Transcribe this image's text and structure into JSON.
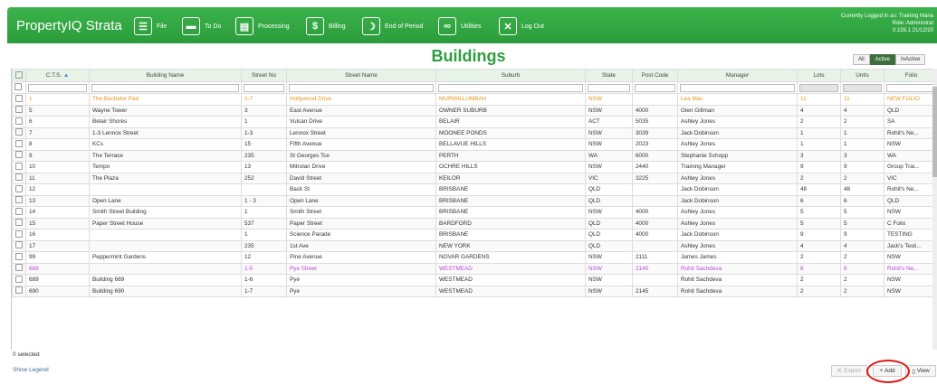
{
  "header": {
    "logo": "PropertyIQ Strata",
    "nav": [
      {
        "label": "File",
        "icon": "file-icon"
      },
      {
        "label": "To Do",
        "icon": "chat-icon"
      },
      {
        "label": "Processing",
        "icon": "document-icon"
      },
      {
        "label": "Billing",
        "icon": "dollar-icon"
      },
      {
        "label": "End of Period",
        "icon": "moon-icon"
      },
      {
        "label": "Utilities",
        "icon": "link-icon"
      },
      {
        "label": "Log Out",
        "icon": "close-icon"
      }
    ],
    "user_line1": "Currently Logged In as: Training Mana",
    "user_line2": "Role: Administrat",
    "user_line3": "0.135.1 21/12/20"
  },
  "page_title": "Buildings",
  "filters": {
    "all": "All",
    "active": "Active",
    "inactive": "InActive"
  },
  "columns": [
    "C.T.S.",
    "Building Name",
    "Street No",
    "Street Name",
    "Suburb",
    "State",
    "Post Code",
    "Manager",
    "Lots",
    "Units",
    "Folio"
  ],
  "sort_indicator": "▲",
  "rows": [
    {
      "cts": "1",
      "name": "The Bachelor Pad",
      "no": "1-7",
      "street": "Hollywood Drive",
      "suburb": "MURWILLUMBAH",
      "state": "NSW",
      "pc": "",
      "mgr": "Lea Mac",
      "lots": "11",
      "units": "11",
      "folio": "NEW FOLIO",
      "style": "orange"
    },
    {
      "cts": "5",
      "name": "Wayne Tower",
      "no": "3",
      "street": "East Avenue",
      "suburb": "OWNER SUBURB",
      "state": "NSW",
      "pc": "4000",
      "mgr": "Glen Gillman",
      "lots": "4",
      "units": "4",
      "folio": "QLD",
      "style": ""
    },
    {
      "cts": "6",
      "name": "Belair Shores",
      "no": "1",
      "street": "Vulcan Drive",
      "suburb": "BELAIR",
      "state": "ACT",
      "pc": "5035",
      "mgr": "Ashley Jones",
      "lots": "2",
      "units": "2",
      "folio": "SA",
      "style": ""
    },
    {
      "cts": "7",
      "name": "1-3 Lennox Street",
      "no": "1-3",
      "street": "Lennox Street",
      "suburb": "MOONEE PONDS",
      "state": "NSW",
      "pc": "3039",
      "mgr": "Jack Dobinson",
      "lots": "1",
      "units": "1",
      "folio": "Rohit's Ne...",
      "style": ""
    },
    {
      "cts": "8",
      "name": "KCs",
      "no": "15",
      "street": "Fifth Avenue",
      "suburb": "BELLAVUE HILLS",
      "state": "NSW",
      "pc": "2023",
      "mgr": "Ashley Jones",
      "lots": "1",
      "units": "1",
      "folio": "NSW",
      "style": ""
    },
    {
      "cts": "9",
      "name": "The Terrace",
      "no": "235",
      "street": "St Georges Tce",
      "suburb": "PERTH",
      "state": "WA",
      "pc": "6000",
      "mgr": "Stephanie Schopp",
      "lots": "3",
      "units": "3",
      "folio": "WA",
      "style": ""
    },
    {
      "cts": "10",
      "name": "Tempo",
      "no": "13",
      "street": "Mitrolan Drive",
      "suburb": "OCHRE HILLS",
      "state": "NSW",
      "pc": "2440",
      "mgr": "Training Manager",
      "lots": "9",
      "units": "9",
      "folio": "Group Trai...",
      "style": ""
    },
    {
      "cts": "11",
      "name": "The Plaza",
      "no": "252",
      "street": "David Street",
      "suburb": "KEILOR",
      "state": "VIC",
      "pc": "3225",
      "mgr": "Ashley Jones",
      "lots": "2",
      "units": "2",
      "folio": "VIC",
      "style": ""
    },
    {
      "cts": "12",
      "name": "",
      "no": "",
      "street": "Back St",
      "suburb": "BRISBANE",
      "state": "QLD",
      "pc": "",
      "mgr": "Jack Dobinson",
      "lots": "48",
      "units": "48",
      "folio": "Rohit's Ne...",
      "style": ""
    },
    {
      "cts": "13",
      "name": "Open Lane",
      "no": "1 - 3",
      "street": "Open Lane",
      "suburb": "BRISBANE",
      "state": "QLD",
      "pc": "",
      "mgr": "Jack Dobinson",
      "lots": "6",
      "units": "6",
      "folio": "QLD",
      "style": ""
    },
    {
      "cts": "14",
      "name": "Smith Street Building",
      "no": "1",
      "street": "Smith Street",
      "suburb": "BRISBANE",
      "state": "NSW",
      "pc": "4000",
      "mgr": "Ashley Jones",
      "lots": "5",
      "units": "5",
      "folio": "NSW",
      "style": ""
    },
    {
      "cts": "15",
      "name": "Paper Street House",
      "no": "537",
      "street": "Paper Street",
      "suburb": "BARDFORD",
      "state": "QLD",
      "pc": "4000",
      "mgr": "Ashley Jones",
      "lots": "5",
      "units": "5",
      "folio": "C Folio",
      "style": ""
    },
    {
      "cts": "16",
      "name": "",
      "no": "1",
      "street": "Science Parade",
      "suburb": "BRISBANE",
      "state": "QLD",
      "pc": "4000",
      "mgr": "Jack Dobinson",
      "lots": "9",
      "units": "9",
      "folio": "TESTING",
      "style": ""
    },
    {
      "cts": "17",
      "name": "",
      "no": "235",
      "street": "1st Ave",
      "suburb": "NEW YORK",
      "state": "QLD",
      "pc": "",
      "mgr": "Ashley Jones",
      "lots": "4",
      "units": "4",
      "folio": "Jack's Testi...",
      "style": ""
    },
    {
      "cts": "99",
      "name": "Peppermint Gardens",
      "no": "12",
      "street": "Pine Avenue",
      "suburb": "NOVAR GARDENS",
      "state": "NSW",
      "pc": "2111",
      "mgr": "James James",
      "lots": "2",
      "units": "2",
      "folio": "NSW",
      "style": ""
    },
    {
      "cts": "688",
      "name": "",
      "no": "1-5",
      "street": "Pye Street",
      "suburb": "WESTMEAD",
      "state": "NSW",
      "pc": "2145",
      "mgr": "Rohit Sachdeva",
      "lots": "8",
      "units": "8",
      "folio": "Rohit's Ne...",
      "style": "purple"
    },
    {
      "cts": "689",
      "name": "Building 689",
      "no": "1-6",
      "street": "Pye",
      "suburb": "WESTMEAD",
      "state": "NSW",
      "pc": "",
      "mgr": "Rohit Sachdeva",
      "lots": "2",
      "units": "2",
      "folio": "NSW",
      "style": ""
    },
    {
      "cts": "690",
      "name": "Building 690",
      "no": "1-7",
      "street": "Pye",
      "suburb": "WESTMEAD",
      "state": "NSW",
      "pc": "2145",
      "mgr": "Rohit Sachdeva",
      "lots": "2",
      "units": "2",
      "folio": "NSW",
      "style": ""
    }
  ],
  "footer": {
    "selected": "0 selected",
    "show_legend": "Show Legend",
    "export": "Export",
    "add": "Add",
    "view": "View"
  }
}
